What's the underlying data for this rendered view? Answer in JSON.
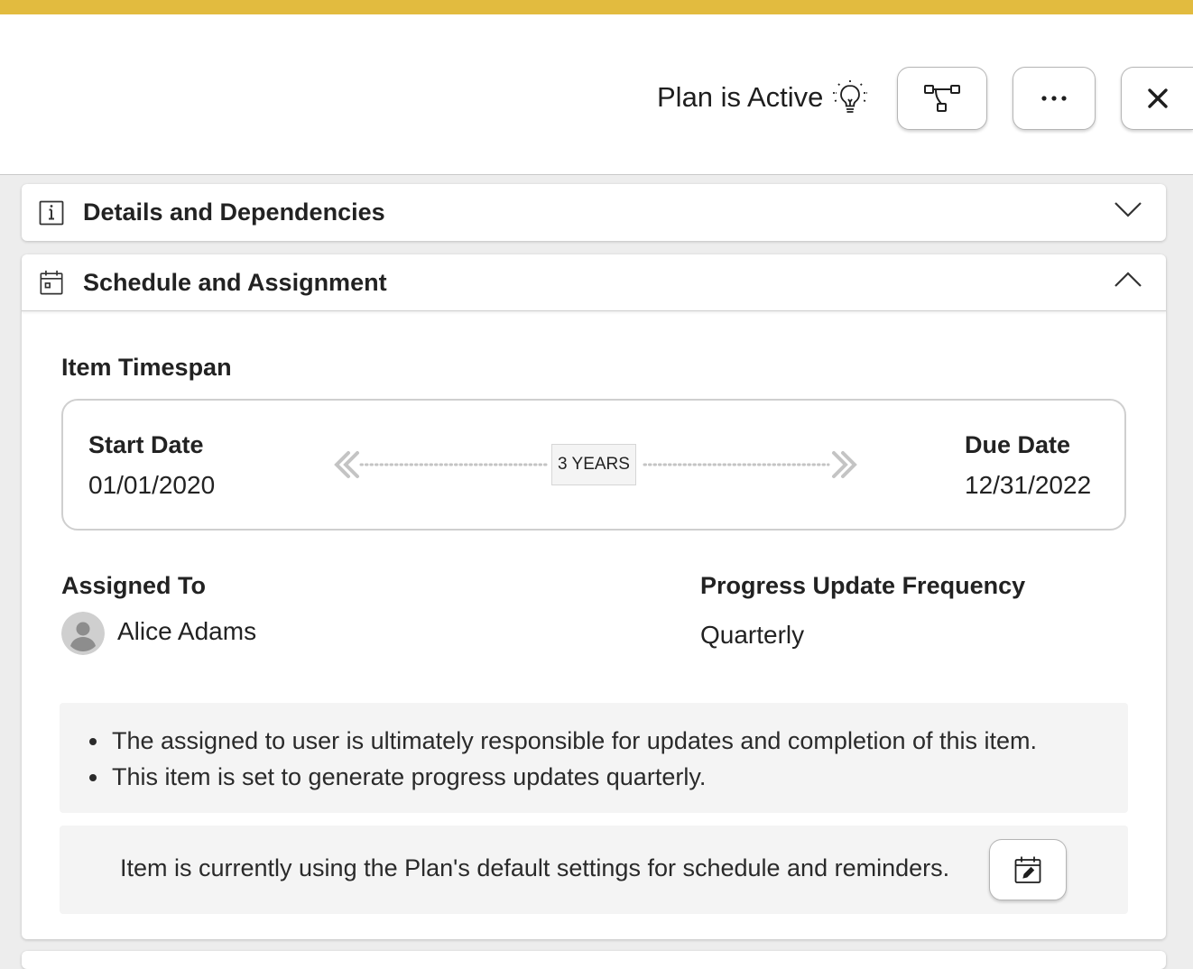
{
  "colors": {
    "accent_bar": "#e2bb3f",
    "panel_bg": "#ffffff",
    "page_bg": "#ededed",
    "note_bg": "#f4f4f4"
  },
  "header": {
    "status_text": "Plan is Active",
    "status_icon": "lightbulb-icon",
    "buttons": [
      {
        "icon": "hierarchy-icon"
      },
      {
        "icon": "more-icon"
      },
      {
        "icon": "close-icon"
      }
    ]
  },
  "details_panel": {
    "title": "Details and Dependencies",
    "icon": "info-icon",
    "expanded": false
  },
  "schedule_panel": {
    "title": "Schedule and Assignment",
    "icon": "calendar-icon",
    "expanded": true,
    "timespan": {
      "section_label": "Item Timespan",
      "start_label": "Start Date",
      "start_value": "01/01/2020",
      "duration_badge": "3 YEARS",
      "due_label": "Due Date",
      "due_value": "12/31/2022"
    },
    "assignment": {
      "assigned_label": "Assigned To",
      "assignee_name": "Alice Adams",
      "frequency_label": "Progress Update Frequency",
      "frequency_value": "Quarterly"
    },
    "notes": [
      "The assigned to user is ultimately responsible for updates and completion of this item.",
      "This item is set to generate progress updates quarterly."
    ],
    "defaults_text": "Item is currently using the Plan's default settings for schedule and reminders.",
    "defaults_button_icon": "calendar-edit-icon"
  }
}
